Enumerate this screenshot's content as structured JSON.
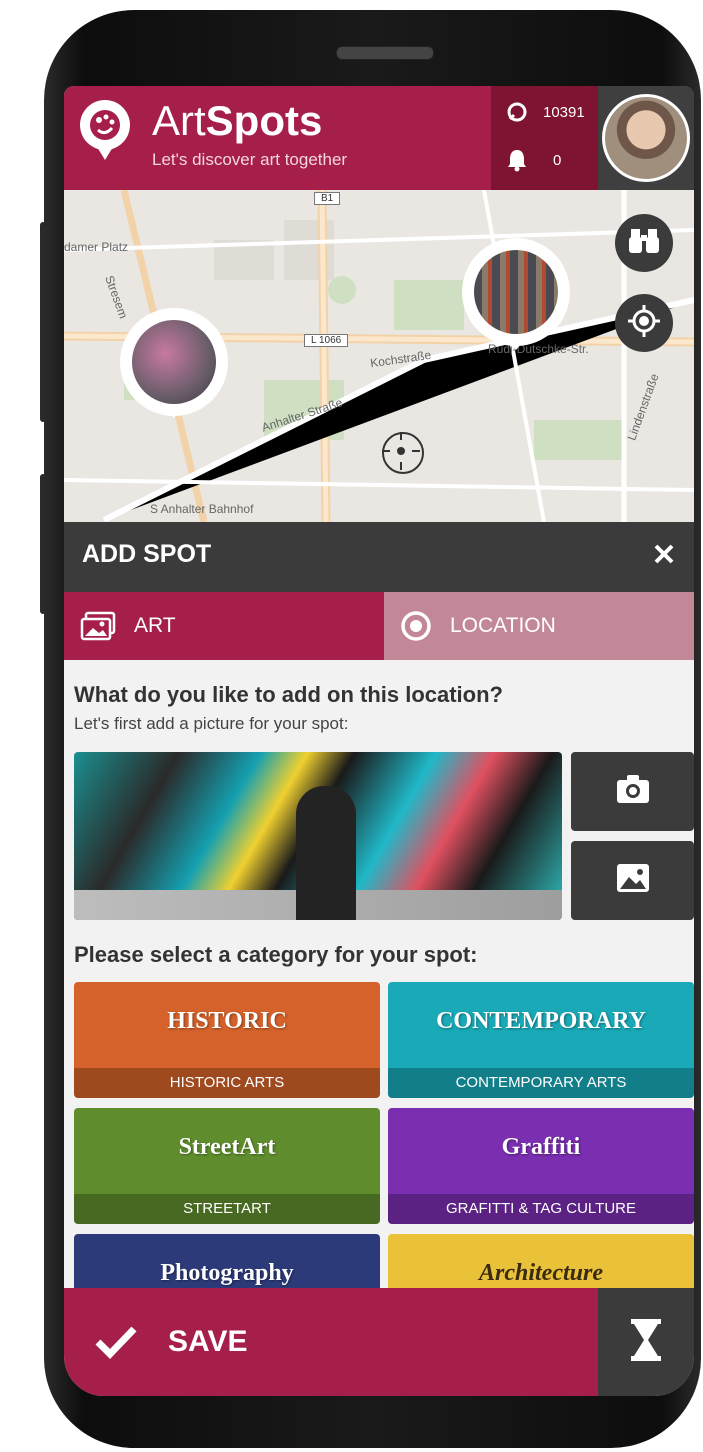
{
  "app": {
    "brand_regular": "Art",
    "brand_bold": "Spots",
    "tagline": "Let's discover art together"
  },
  "stats": {
    "points": "10391",
    "notifications": "0"
  },
  "map": {
    "labels": {
      "platz": "damer Platz",
      "b1": "B1",
      "l1066": "L 1066",
      "kochstrasse": "Kochstraße",
      "rudi": "Rudi-Dutschke-Str.",
      "anhalter": "Anhalter Straße",
      "lindenstrasse": "Lindenstraße",
      "stresemann": "Stresem",
      "bahnhof": "S Anhalter Bahnhof"
    }
  },
  "panel": {
    "title": "ADD SPOT",
    "tabs": [
      {
        "label": "ART",
        "active": true
      },
      {
        "label": "LOCATION",
        "active": false
      }
    ],
    "question": "What do you like to add on this location?",
    "subtext": "Let's first add a picture for your spot:",
    "category_prompt": "Please select a category for your spot:",
    "categories": [
      {
        "title": "HISTORIC",
        "caption": "HISTORIC ARTS",
        "color": "#d4622a"
      },
      {
        "title": "CONTEMPORARY",
        "caption": "CONTEMPORARY ARTS",
        "color": "#19a9b7"
      },
      {
        "title": "StreetArt",
        "caption": "STREETART",
        "color": "#5f8d2d"
      },
      {
        "title": "Graffiti",
        "caption": "GRAFITTI & TAG CULTURE",
        "color": "#7a2eb0"
      },
      {
        "title": "Photography",
        "caption": "",
        "color": "#2c3a7a"
      },
      {
        "title": "Architecture",
        "caption": "",
        "color": "#e9c23a"
      }
    ]
  },
  "actions": {
    "save_label": "SAVE"
  },
  "colors": {
    "accent": "#a51f4a",
    "dark": "#3b3b3b",
    "tab_inactive": "#c38898"
  },
  "icons": [
    "artspots-logo-icon",
    "points-icon",
    "bell-icon",
    "binoculars-icon",
    "locate-icon",
    "close-icon",
    "picture-icon",
    "radio-icon",
    "camera-icon",
    "gallery-icon",
    "check-icon",
    "hourglass-icon"
  ]
}
